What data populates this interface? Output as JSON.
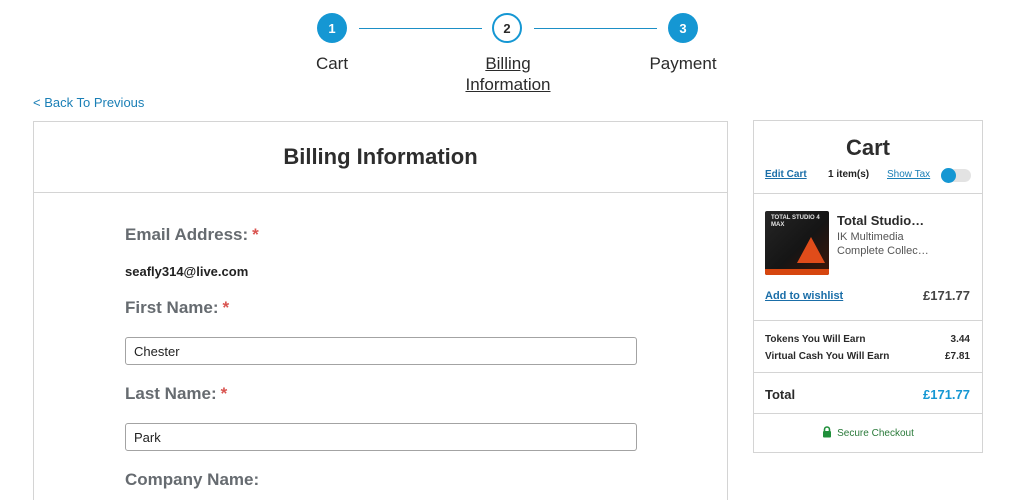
{
  "stepper": {
    "steps": [
      {
        "number": "1",
        "label": "Cart",
        "state": "complete"
      },
      {
        "number": "2",
        "label_line1": "Billing",
        "label_line2": "Information",
        "state": "current"
      },
      {
        "number": "3",
        "label": "Payment",
        "state": "complete"
      }
    ]
  },
  "back_link": "< Back To Previous",
  "billing": {
    "title": "Billing Information",
    "email_label": "Email Address:",
    "email_value": "seafly314@live.com",
    "first_name_label": "First Name:",
    "first_name_value": "Chester",
    "last_name_label": "Last Name:",
    "last_name_value": "Park",
    "company_label": "Company Name:",
    "required_marker": "*"
  },
  "cart": {
    "title": "Cart",
    "edit_cart": "Edit Cart",
    "item_count": "1 item(s)",
    "show_tax": "Show Tax",
    "show_tax_enabled": false,
    "product": {
      "name": "Total Studio…",
      "brand": "IK Multimedia",
      "description": "Complete Collec…",
      "image_text": "TOTAL STUDIO 4 MAX",
      "price": "£171.77"
    },
    "add_to_wishlist": "Add to wishlist",
    "tokens_label": "Tokens You Will Earn",
    "tokens_value": "3.44",
    "virtual_cash_label": "Virtual Cash You Will Earn",
    "virtual_cash_value": "£7.81",
    "total_label": "Total",
    "total_value": "£171.77",
    "secure_checkout": "Secure Checkout"
  },
  "colors": {
    "accent": "#1597d3",
    "link": "#1a6ea8",
    "required": "#d9534f",
    "secure": "#2a7a3a"
  },
  "icons": [
    "lock-icon"
  ]
}
